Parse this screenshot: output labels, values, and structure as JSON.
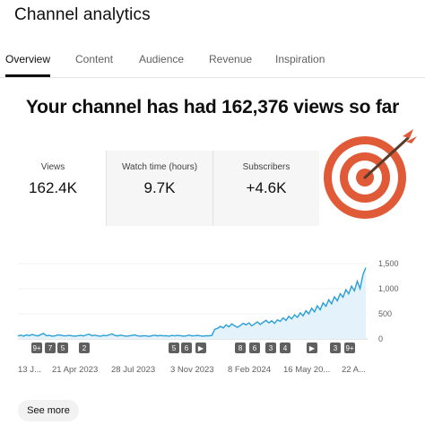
{
  "header": {
    "title": "Channel analytics"
  },
  "tabs": [
    {
      "label": "Overview"
    },
    {
      "label": "Content"
    },
    {
      "label": "Audience"
    },
    {
      "label": "Revenue"
    },
    {
      "label": "Inspiration"
    }
  ],
  "headline": "Your channel has had 162,376 views so far",
  "stats": [
    {
      "label": "Views",
      "value": "162.4K"
    },
    {
      "label": "Watch time (hours)",
      "value": "9.7K"
    },
    {
      "label": "Subscribers",
      "value": "+4.6K"
    }
  ],
  "colors": {
    "line": "#2a9fd8",
    "area": "#e3f2fb",
    "target_red": "#e05a37",
    "target_white": "#ffffff",
    "marker_bg": "#5f5f5f"
  },
  "icons": [
    "target-icon",
    "arrow-icon"
  ],
  "chart_data": {
    "type": "area",
    "x_tick_labels": [
      "13 J...",
      "21 Apr 2023",
      "28 Jul 2023",
      "3 Nov 2023",
      "8 Feb 2024",
      "16 May 20...",
      "22 A..."
    ],
    "y_tick_labels": [
      "1,500",
      "1,000",
      "500",
      "0"
    ],
    "ylim": [
      0,
      1500
    ],
    "series": [
      {
        "values": [
          60,
          75,
          55,
          80,
          65,
          90,
          70,
          60,
          85,
          110,
          65,
          70,
          55,
          60,
          80,
          75,
          60,
          65,
          70,
          60,
          55,
          65,
          70,
          60,
          80,
          95,
          65,
          75,
          60,
          55,
          70,
          65,
          80,
          100,
          70,
          60,
          75,
          65,
          55,
          60,
          70,
          80,
          60,
          55,
          65,
          60,
          50,
          65,
          75,
          60,
          70,
          60,
          65,
          55,
          70,
          60,
          70,
          65,
          55,
          60,
          75,
          60,
          65,
          70,
          60,
          55,
          65,
          60,
          70,
          190,
          210,
          250,
          220,
          280,
          240,
          300,
          260,
          230,
          270,
          310,
          280,
          320,
          260,
          300,
          340,
          290,
          330,
          370,
          320,
          360,
          310,
          380,
          350,
          420,
          370,
          450,
          400,
          480,
          430,
          520,
          460,
          560,
          500,
          610,
          540,
          660,
          580,
          720,
          650,
          780,
          700,
          840,
          760,
          900,
          830,
          980,
          900,
          1050,
          960,
          1150,
          1000,
          1280,
          1420
        ]
      }
    ],
    "markers": [
      {
        "label": "9+",
        "group": 0
      },
      {
        "label": "7",
        "group": 0
      },
      {
        "label": "5",
        "group": 0
      },
      {
        "label": "2",
        "group": 1
      },
      {
        "label": "5",
        "group": 2
      },
      {
        "label": "6",
        "group": 2
      },
      {
        "label": "▶",
        "group": 2
      },
      {
        "label": "8",
        "group": 3
      },
      {
        "label": "6",
        "group": 3
      },
      {
        "label": "3",
        "group": 3
      },
      {
        "label": "4",
        "group": 3
      },
      {
        "label": "▶",
        "group": 4
      },
      {
        "label": "3",
        "group": 5
      },
      {
        "label": "9+",
        "group": 5
      }
    ]
  },
  "footer": {
    "see_more": "See more"
  }
}
